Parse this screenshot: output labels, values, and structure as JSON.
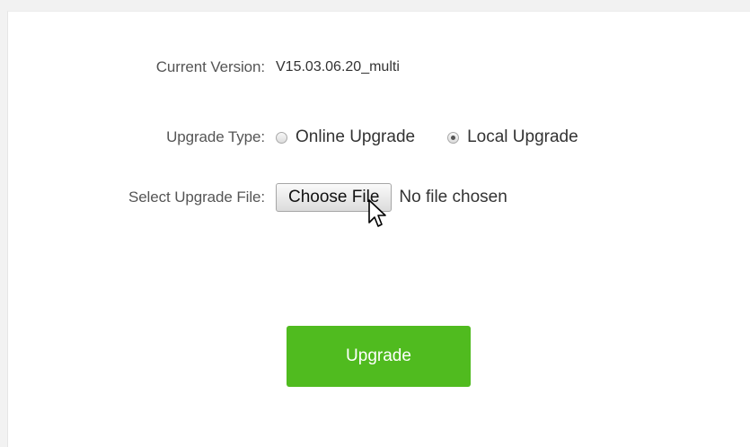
{
  "form": {
    "current_version": {
      "label": "Current Version:",
      "value": "V15.03.06.20_multi"
    },
    "upgrade_type": {
      "label": "Upgrade Type:",
      "options": [
        {
          "label": "Online Upgrade",
          "checked": false
        },
        {
          "label": "Local Upgrade",
          "checked": true
        }
      ]
    },
    "select_file": {
      "label": "Select Upgrade File:",
      "button_label": "Choose File",
      "status": "No file chosen"
    },
    "upgrade_button": {
      "label": "Upgrade"
    }
  },
  "colors": {
    "upgrade_button": "#50bb1f",
    "page_background": "#f2f2f2",
    "panel_background": "#ffffff"
  },
  "icons": {
    "cursor": "arrow-cursor-icon"
  }
}
